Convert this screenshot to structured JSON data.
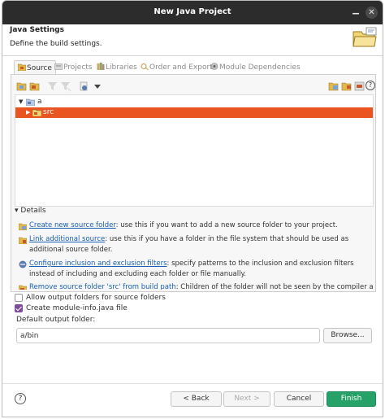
{
  "window": {
    "title": "New Java Project",
    "minimize_glyph": "▁",
    "close_glyph": "✕"
  },
  "header": {
    "title": "Java Settings",
    "description": "Define the build settings."
  },
  "tabs": [
    {
      "label": "Source",
      "icon": "source-folder-icon",
      "active": true
    },
    {
      "label": "Projects",
      "icon": "projects-icon",
      "active": false
    },
    {
      "label": "Libraries",
      "icon": "libraries-icon",
      "active": false
    },
    {
      "label": "Order and Export",
      "icon": "order-export-icon",
      "active": false
    },
    {
      "label": "Module Dependencies",
      "icon": "module-icon",
      "active": false
    }
  ],
  "toolbar": {
    "left_icons": [
      "expand-folder-icon",
      "add-folder-icon",
      "filter-icon",
      "filter-disabled-icon",
      "link-icon",
      "dropdown-arrow-icon"
    ],
    "right_icons": [
      "new-source-folder-icon",
      "link-folder-icon",
      "configure-icon",
      "help-icon"
    ],
    "help_glyph": "?"
  },
  "tree": {
    "root": {
      "label": "a",
      "expanded": true
    },
    "child": {
      "label": "src",
      "selected": true
    }
  },
  "details": {
    "heading": "Details",
    "items": [
      {
        "link": "Create new source folder",
        "text": ": use this if you want to add a new source folder to your project."
      },
      {
        "link": "Link additional source",
        "text": ": use this if you have a folder in the file system that should be used as additional source folder."
      },
      {
        "link": "Configure inclusion and exclusion filters",
        "text": ": specify patterns to the inclusion and exclusion filters instead of including and excluding each folder or file manually."
      },
      {
        "link": "Remove source folder 'src' from build path",
        "text": ": Children of the folder will not be seen by the compiler anymore and"
      }
    ]
  },
  "options": {
    "allow_output_folders": {
      "label": "Allow output folders for source folders",
      "checked": false
    },
    "create_module_info": {
      "label": "Create module-info.java file",
      "checked": true
    }
  },
  "output": {
    "label": "Default output folder:",
    "value": "a/bin",
    "browse_label": "Browse..."
  },
  "buttons": {
    "back": "< Back",
    "next": "Next >",
    "cancel": "Cancel",
    "finish": "Finish",
    "help_glyph": "?"
  },
  "colors": {
    "selection": "#e95420",
    "finish": "#26a269",
    "link": "#1a5fb4",
    "checkbox": "#7d4d99",
    "titlebar": "#2c2c2c"
  }
}
